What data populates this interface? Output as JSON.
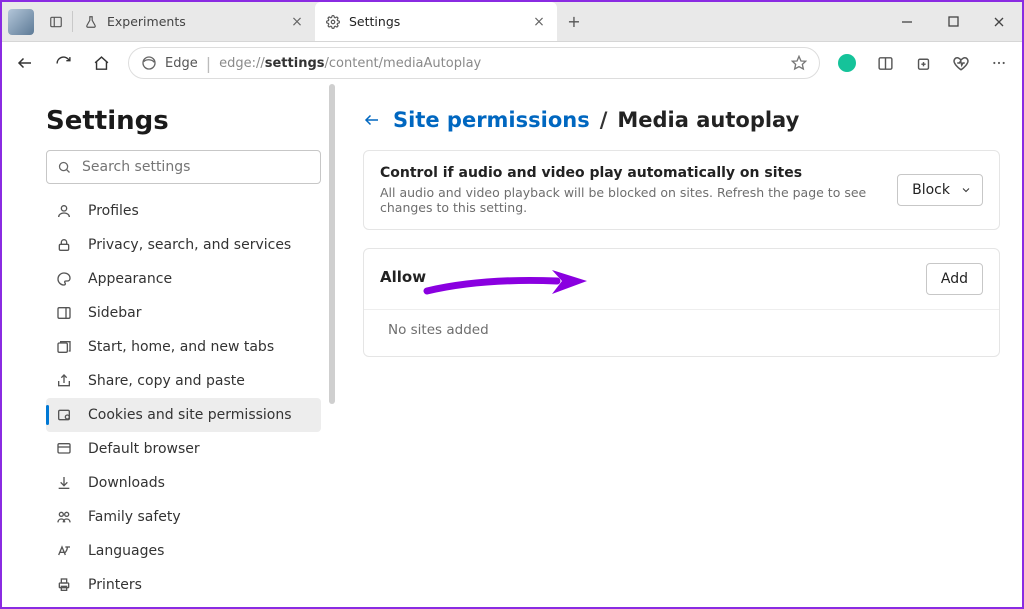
{
  "tabs": [
    {
      "label": "Experiments",
      "active": false
    },
    {
      "label": "Settings",
      "active": true
    }
  ],
  "address": {
    "browser_name": "Edge",
    "url_prefix": "edge://",
    "url_bold": "settings",
    "url_suffix": "/content/mediaAutoplay"
  },
  "sidebar": {
    "heading": "Settings",
    "search_placeholder": "Search settings",
    "items": [
      {
        "label": "Profiles"
      },
      {
        "label": "Privacy, search, and services"
      },
      {
        "label": "Appearance"
      },
      {
        "label": "Sidebar"
      },
      {
        "label": "Start, home, and new tabs"
      },
      {
        "label": "Share, copy and paste"
      },
      {
        "label": "Cookies and site permissions"
      },
      {
        "label": "Default browser"
      },
      {
        "label": "Downloads"
      },
      {
        "label": "Family safety"
      },
      {
        "label": "Languages"
      },
      {
        "label": "Printers"
      }
    ],
    "active_index": 6
  },
  "main": {
    "breadcrumb_link": "Site permissions",
    "breadcrumb_sep": "/",
    "breadcrumb_current": "Media autoplay",
    "control_card": {
      "title": "Control if audio and video play automatically on sites",
      "subtitle": "All audio and video playback will be blocked on sites. Refresh the page to see changes to this setting.",
      "dropdown_value": "Block"
    },
    "allow_card": {
      "title": "Allow",
      "add_label": "Add",
      "empty_text": "No sites added"
    }
  },
  "colors": {
    "accent": "#0067c0",
    "annotation": "#8a00e0"
  }
}
